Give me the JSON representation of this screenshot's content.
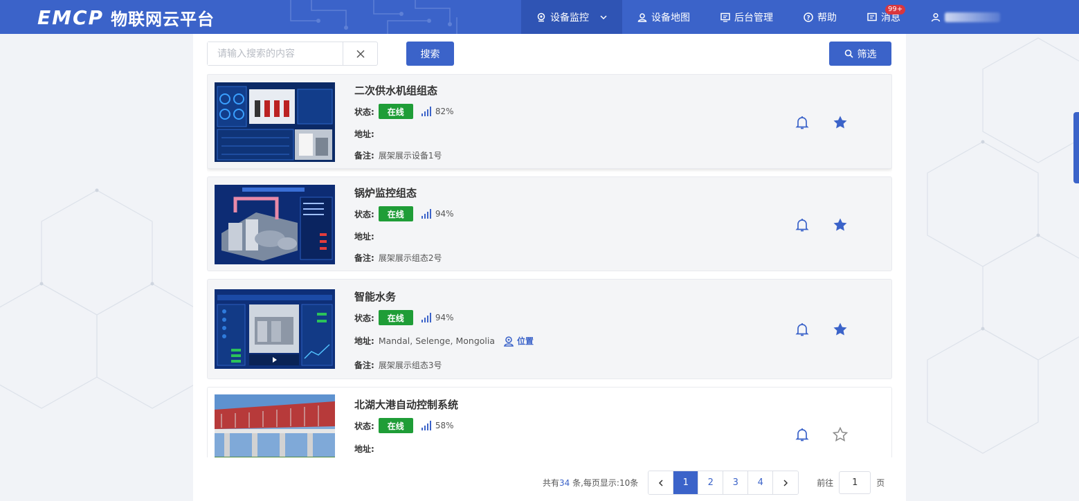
{
  "header": {
    "brand": "EMCP",
    "brand_sub": "物联网云平台",
    "nav": [
      {
        "label": "设备监控",
        "icon": "location-pin-icon",
        "active": true
      },
      {
        "label": "设备地图",
        "icon": "map-user-icon"
      },
      {
        "label": "后台管理",
        "icon": "admin-screen-icon"
      },
      {
        "label": "帮助",
        "icon": "help-circle-icon"
      },
      {
        "label": "消息",
        "icon": "message-icon",
        "badge": "99+"
      },
      {
        "label": "",
        "icon": "user-icon"
      }
    ]
  },
  "search": {
    "placeholder": "请输入搜索的内容",
    "value": "",
    "search_label": "搜索",
    "filter_label": "筛选"
  },
  "labels": {
    "status": "状态:",
    "address": "地址:",
    "note": "备注:",
    "online": "在线",
    "location": "位置"
  },
  "devices": [
    {
      "title": "二次供水机组组态",
      "signal": "82%",
      "address": "",
      "note": "展架展示设备1号",
      "favorite": true
    },
    {
      "title": "锅炉监控组态",
      "signal": "94%",
      "address": "",
      "note": "展架展示组态2号",
      "favorite": true
    },
    {
      "title": "智能水务",
      "signal": "94%",
      "address": "Mandal, Selenge, Mongolia",
      "note": "展架展示组态3号",
      "favorite": true
    },
    {
      "title": "北湖大港自动控制系统",
      "signal": "58%",
      "address": "",
      "note": "",
      "favorite": false
    }
  ],
  "pagination": {
    "total_prefix": "共有",
    "total": "34",
    "total_suffix": " 条,每页显示:",
    "per_page": "10条",
    "pages": [
      "1",
      "2",
      "3",
      "4"
    ],
    "current": "1",
    "goto_prefix": "前往",
    "goto_value": "1",
    "goto_suffix": "页"
  },
  "colors": {
    "primary": "#3b63c9",
    "online": "#1f9d37",
    "badge": "#d9363e"
  }
}
